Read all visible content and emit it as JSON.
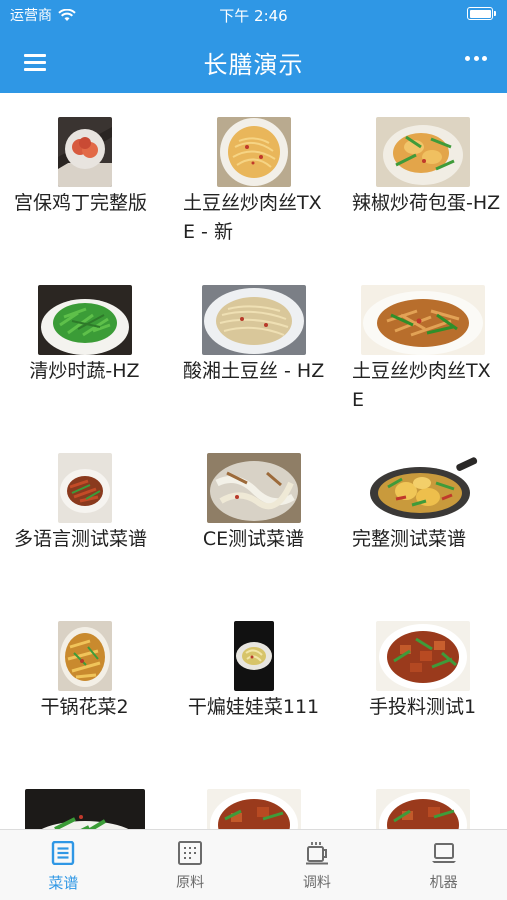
{
  "status": {
    "carrier": "运营商",
    "time": "下午 2:46"
  },
  "nav": {
    "title": "长膳演示"
  },
  "recipes": [
    {
      "name": "宫保鸡丁完整版"
    },
    {
      "name": "土豆丝炒肉丝TXE - 新"
    },
    {
      "name": "辣椒炒荷包蛋-HZ"
    },
    {
      "name": "清炒时蔬-HZ"
    },
    {
      "name": "酸湘土豆丝 - HZ"
    },
    {
      "name": "土豆丝炒肉丝TXE"
    },
    {
      "name": "多语言测试菜谱"
    },
    {
      "name": "CE测试菜谱"
    },
    {
      "name": "完整测试菜谱"
    },
    {
      "name": "干锅花菜2"
    },
    {
      "name": "干煸娃娃菜111"
    },
    {
      "name": "手投料测试1"
    },
    {
      "name": ""
    },
    {
      "name": ""
    },
    {
      "name": ""
    }
  ],
  "tabs": [
    {
      "label": "菜谱",
      "icon": "recipe-list-icon",
      "active": true
    },
    {
      "label": "原料",
      "icon": "ingredients-grid-icon",
      "active": false
    },
    {
      "label": "调料",
      "icon": "seasoning-cup-icon",
      "active": false
    },
    {
      "label": "机器",
      "icon": "machine-laptop-icon",
      "active": false
    }
  ],
  "colors": {
    "primary": "#2f97e5",
    "tab_inactive": "#6b6b6b"
  }
}
